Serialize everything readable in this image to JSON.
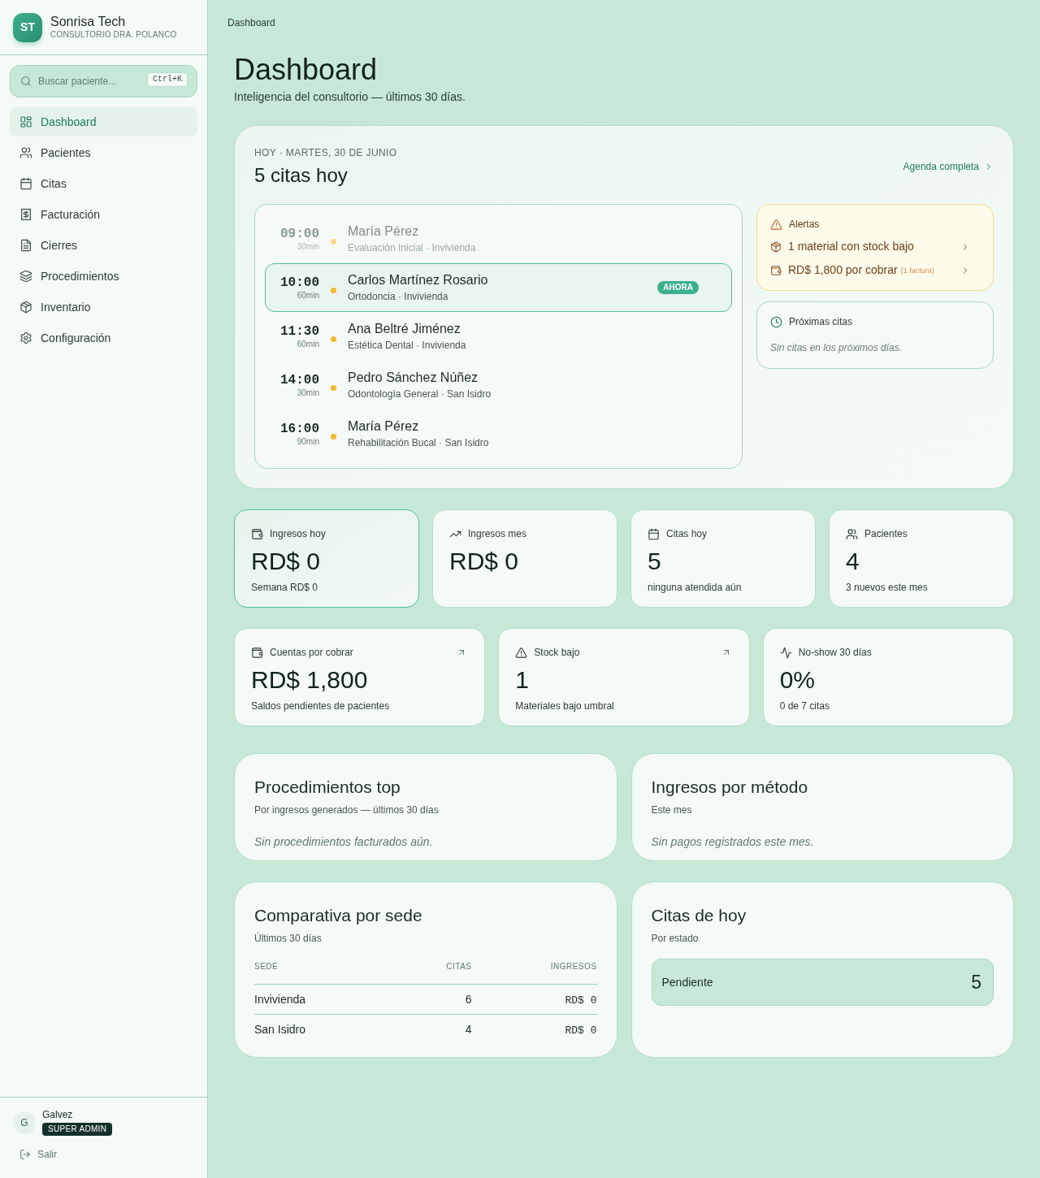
{
  "sidebar": {
    "brand": {
      "logo": "ST",
      "name": "Sonrisa Tech",
      "subtitle": "CONSULTORIO DRA. POLANCO"
    },
    "search": {
      "placeholder": "Buscar paciente...",
      "shortcut": "Ctrl+K"
    },
    "items": [
      {
        "label": "Dashboard",
        "selected": true
      },
      {
        "label": "Pacientes",
        "selected": false
      },
      {
        "label": "Citas",
        "selected": false
      },
      {
        "label": "Facturación",
        "selected": false
      },
      {
        "label": "Cierres",
        "selected": false
      },
      {
        "label": "Procedimientos",
        "selected": false
      },
      {
        "label": "Inventario",
        "selected": false
      },
      {
        "label": "Configuración",
        "selected": false
      }
    ],
    "user": {
      "initial": "G",
      "name": "Galvez",
      "role": "SUPER ADMIN"
    },
    "logout": "Salir"
  },
  "breadcrumb": "Dashboard",
  "header": {
    "title": "Dashboard",
    "subtitle": "Inteligencia del consultorio — últimos 30 días."
  },
  "today": {
    "date_label": "HOY · MARTES, 30 DE JUNIO",
    "title": "5 citas hoy",
    "link": "Agenda completa",
    "appointments": [
      {
        "time": "09:00",
        "duration": "30min",
        "patient": "María Pérez",
        "detail": "Evaluación Inicial · Invivienda",
        "past": true,
        "current": false
      },
      {
        "time": "10:00",
        "duration": "60min",
        "patient": "Carlos Martínez Rosario",
        "detail": "Ortodoncia · Invivienda",
        "past": false,
        "current": true,
        "badge": "AHORA"
      },
      {
        "time": "11:30",
        "duration": "60min",
        "patient": "Ana Beltré Jiménez",
        "detail": "Estética Dental · Invivienda",
        "past": false,
        "current": false
      },
      {
        "time": "14:00",
        "duration": "30min",
        "patient": "Pedro Sánchez Núñez",
        "detail": "Odontología General · San Isidro",
        "past": false,
        "current": false
      },
      {
        "time": "16:00",
        "duration": "90min",
        "patient": "María Pérez",
        "detail": "Rehabilitación Bucal · San Isidro",
        "past": false,
        "current": false
      }
    ],
    "alerts": {
      "title": "Alertas",
      "items": [
        {
          "text": "1 material con stock bajo"
        },
        {
          "text": "RD$ 1,800 por cobrar",
          "note": "(1 factura)"
        }
      ]
    },
    "upcoming": {
      "title": "Próximas citas",
      "empty": "Sin citas en los próximos días."
    }
  },
  "stats": [
    {
      "label": "Ingresos hoy",
      "value": "RD$ 0",
      "note": "Semana RD$ 0",
      "highlighted": true
    },
    {
      "label": "Ingresos mes",
      "value": "RD$ 0",
      "highlighted": false
    },
    {
      "label": "Citas hoy",
      "value": "5",
      "note": "ninguna atendida aún",
      "highlighted": false
    },
    {
      "label": "Pacientes",
      "value": "4",
      "note": "3 nuevos este mes",
      "highlighted": false
    }
  ],
  "stats_secondary": [
    {
      "label": "Cuentas por cobrar",
      "value": "RD$ 1,800",
      "note": "Saldos pendientes de pacientes",
      "linked": true
    },
    {
      "label": "Stock bajo",
      "value": "1",
      "note": "Materiales bajo umbral",
      "linked": true
    },
    {
      "label": "No-show 30 días",
      "value": "0%",
      "note": "0 de 7 citas",
      "linked": false
    }
  ],
  "top_procedures": {
    "title": "Procedimientos top",
    "subtitle": "Por ingresos generados — últimos 30 días",
    "empty": "Sin procedimientos facturados aún."
  },
  "income_by_method": {
    "title": "Ingresos por método",
    "subtitle": "Este mes",
    "empty": "Sin pagos registrados este mes."
  },
  "branch_comparison": {
    "title": "Comparativa por sede",
    "subtitle": "Últimos 30 días",
    "columns": [
      "SEDE",
      "CITAS",
      "INGRESOS"
    ],
    "rows": [
      [
        "Invivienda",
        "6",
        "RD$ 0"
      ],
      [
        "San Isidro",
        "4",
        "RD$ 0"
      ]
    ]
  },
  "today_by_status": {
    "title": "Citas de hoy",
    "subtitle": "Por estado",
    "items": [
      {
        "label": "Pendiente",
        "count": "5"
      }
    ]
  }
}
